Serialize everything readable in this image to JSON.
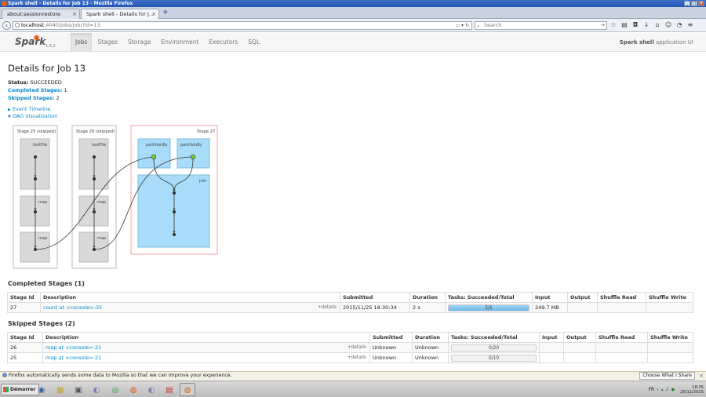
{
  "window": {
    "title": "Spark shell - Details for Job 13 - Mozilla Firefox"
  },
  "tabs": [
    {
      "label": "about:sessionrestore"
    },
    {
      "label": "Spark shell - Details for J..."
    }
  ],
  "navbar": {
    "url_host": "localhost",
    "url_path": ":4040/jobs/job/?id=13",
    "search_placeholder": "Search"
  },
  "spark": {
    "logo": "Spark",
    "version": "1.5.2",
    "tabs": [
      {
        "label": "Jobs",
        "active": true
      },
      {
        "label": "Stages"
      },
      {
        "label": "Storage"
      },
      {
        "label": "Environment"
      },
      {
        "label": "Executors"
      },
      {
        "label": "SQL"
      }
    ],
    "app_name": "Spark shell",
    "app_suffix": " application UI"
  },
  "job": {
    "title": "Details for Job 13",
    "status_label": "Status:",
    "status_value": " SUCCEEDED",
    "completed_label": "Completed Stages:",
    "completed_value": " 1",
    "skipped_label": "Skipped Stages:",
    "skipped_value": " 2",
    "event_timeline": "Event Timeline",
    "dag_visualization": "DAG Visualization"
  },
  "dag": {
    "clusters": [
      {
        "label": "Stage 25 (skipped)",
        "nodes": [
          "textFile",
          "map",
          "map"
        ]
      },
      {
        "label": "Stage 26 (skipped)",
        "nodes": [
          "textFile",
          "map",
          "map"
        ]
      },
      {
        "label": "Stage 27",
        "nodes": [
          "partitionBy",
          "partitionBy",
          "join"
        ]
      }
    ]
  },
  "completed": {
    "title": "Completed Stages (1)",
    "headers": [
      "Stage Id",
      "Description",
      "Submitted",
      "Duration",
      "Tasks: Succeeded/Total",
      "Input",
      "Output",
      "Shuffle Read",
      "Shuffle Write"
    ],
    "rows": [
      {
        "id": "27",
        "desc": "count at <console>:35",
        "details": "+details",
        "submitted": "2015/11/25 18:30:34",
        "duration": "2 s",
        "tasks": "5/5",
        "progress": 1.0,
        "input": "249.7 MB",
        "output": "",
        "shuffle_read": "",
        "shuffle_write": ""
      }
    ]
  },
  "skipped": {
    "title": "Skipped Stages (2)",
    "headers": [
      "Stage Id",
      "Description",
      "Submitted",
      "Duration",
      "Tasks: Succeeded/Total",
      "Input",
      "Output",
      "Shuffle Read",
      "Shuffle Write"
    ],
    "rows": [
      {
        "id": "26",
        "desc": "map at <console>:21",
        "details": "+details",
        "submitted": "Unknown",
        "duration": "Unknown",
        "tasks": "0/20",
        "progress": 0,
        "input": "",
        "output": "",
        "shuffle_read": "",
        "shuffle_write": ""
      },
      {
        "id": "25",
        "desc": "map at <console>:21",
        "details": "+details",
        "submitted": "Unknown",
        "duration": "Unknown",
        "tasks": "0/10",
        "progress": 0,
        "input": "",
        "output": "",
        "shuffle_read": "",
        "shuffle_write": ""
      }
    ]
  },
  "notification": {
    "text": "Firefox automatically sends some data to Mozilla so that we can improve your experience.",
    "button": "Choose What I Share"
  },
  "taskbar": {
    "start": "Démarrer",
    "lang": "FR",
    "time": "18:35",
    "date": "25/11/2015"
  },
  "colors": {
    "link": "#0088cc",
    "rdd_stage": "#d9d9d9",
    "rdd_active": "#a8dcf8",
    "progress": "#6bb8e8"
  }
}
